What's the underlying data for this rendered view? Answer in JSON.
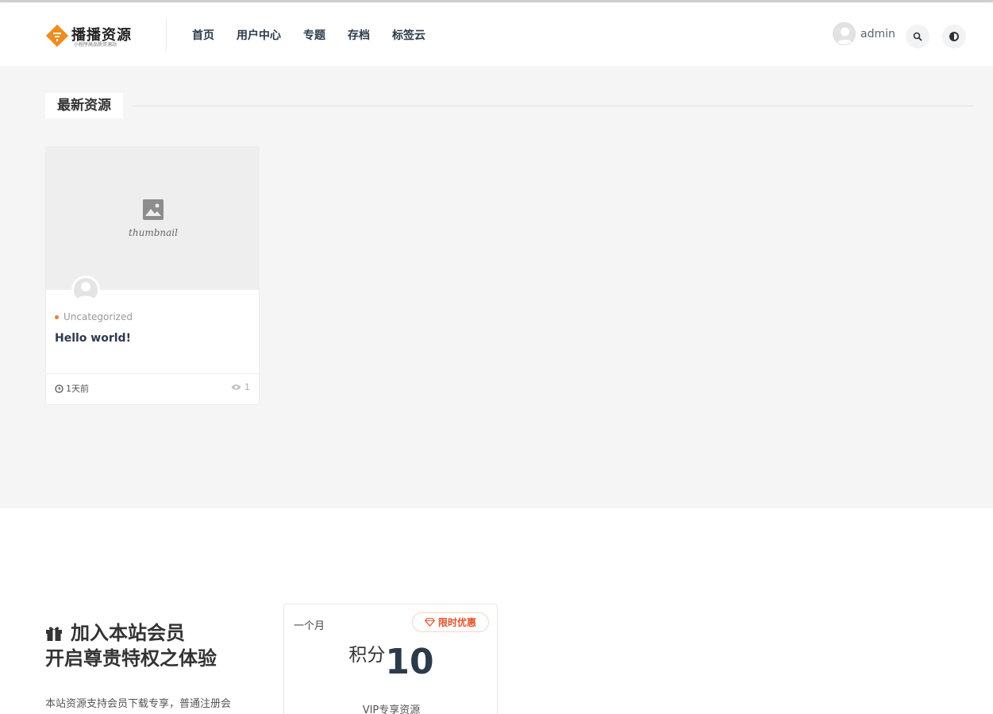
{
  "header": {
    "logo_title": "播播资源",
    "logo_subtitle": "小程序高品质资源站",
    "nav": [
      "首页",
      "用户中心",
      "专题",
      "存档",
      "标签云"
    ],
    "username": "admin"
  },
  "latest": {
    "section_title": "最新资源",
    "posts": [
      {
        "thumbnail_label": "thumbnail",
        "category": "Uncategorized",
        "title": "Hello world!",
        "time": "1天前",
        "views": "1"
      }
    ]
  },
  "vip": {
    "heading_line1": "加入本站会员",
    "heading_line2": "开启尊贵特权之体验",
    "description": "本站资源支持会员下载专享，普通注册会",
    "plan": {
      "period": "一个月",
      "badge": "限时优惠",
      "price_unit": "积分",
      "price_amount": "10",
      "note": "VIP专享资源"
    }
  },
  "colors": {
    "accent": "#f08c1f",
    "badge": "#e5522c",
    "nav_text": "#2d3a4a",
    "band_bg": "#f5f5f5"
  }
}
